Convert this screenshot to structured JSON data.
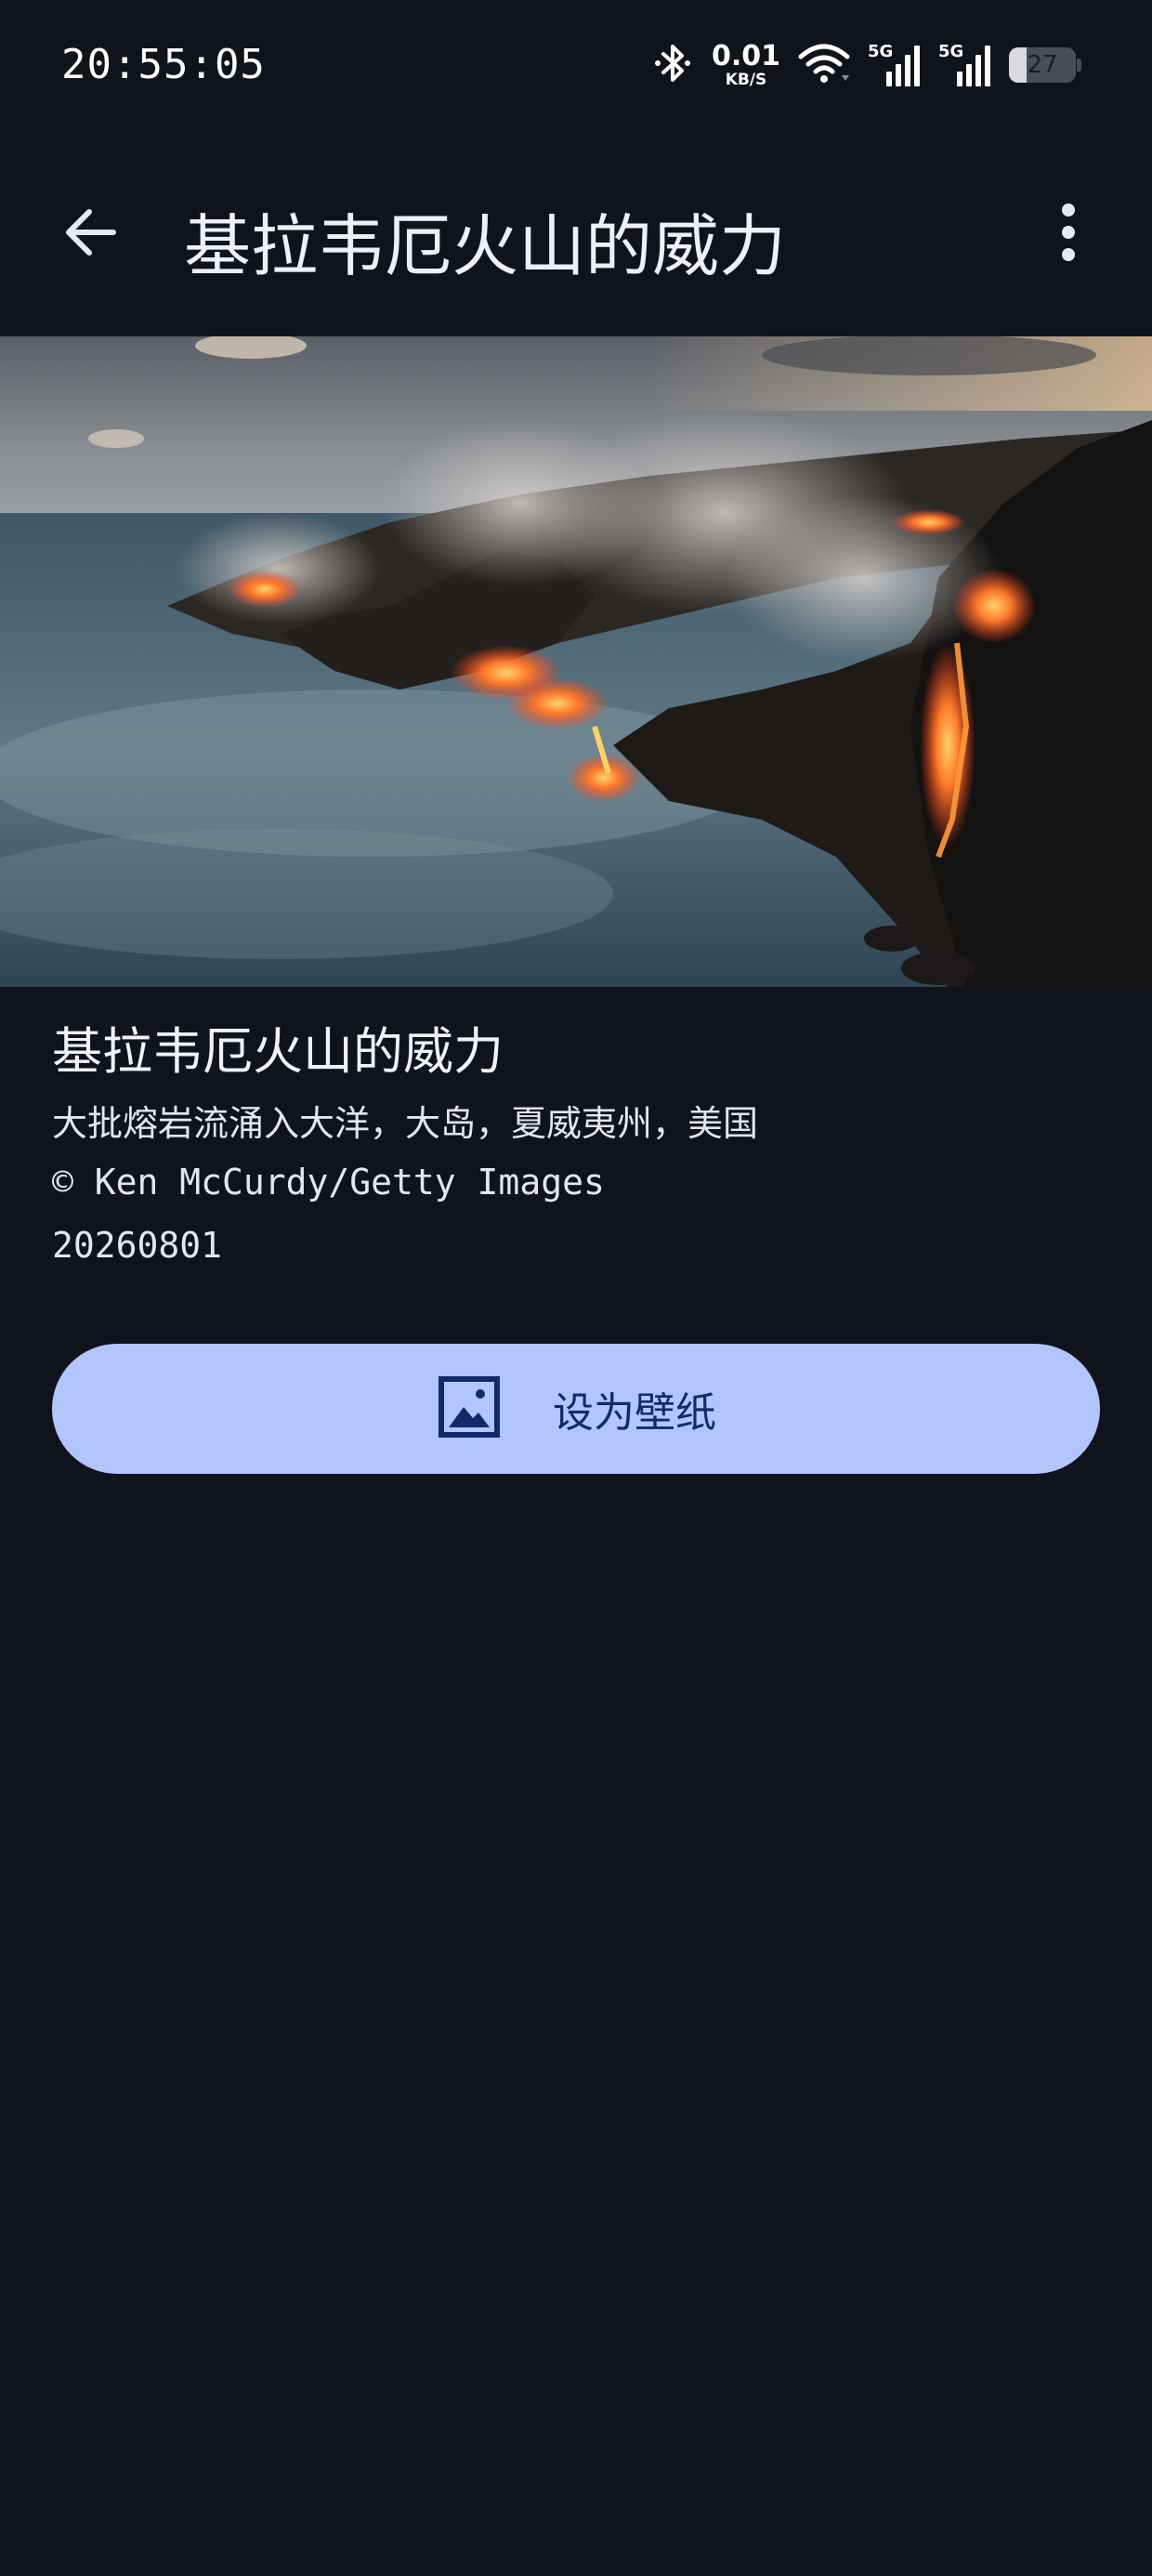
{
  "status_bar": {
    "time": "20:55:05",
    "net_speed_value": "0.01",
    "net_speed_unit": "KB/S",
    "sim1_type": "5G",
    "sim2_type": "5G",
    "battery_level": "27",
    "battery_fraction": 0.27
  },
  "app_bar": {
    "title": "基拉韦厄火山的威力",
    "back_icon": "arrow-back-icon",
    "more_icon": "more-vert-icon"
  },
  "image": {
    "description_icon": "lava-ocean-photo"
  },
  "details": {
    "title": "基拉韦厄火山的威力",
    "subtitle": "大批熔岩流涌入大洋，大岛，夏威夷州，美国",
    "copyright": "© Ken McCurdy/Getty Images",
    "date": "20260801"
  },
  "actions": {
    "set_wallpaper_label": "设为壁纸",
    "set_wallpaper_icon": "wallpaper-icon"
  },
  "colors": {
    "background": "#11131c",
    "button_bg": "#b3c5fe",
    "button_fg": "#122a6b"
  }
}
